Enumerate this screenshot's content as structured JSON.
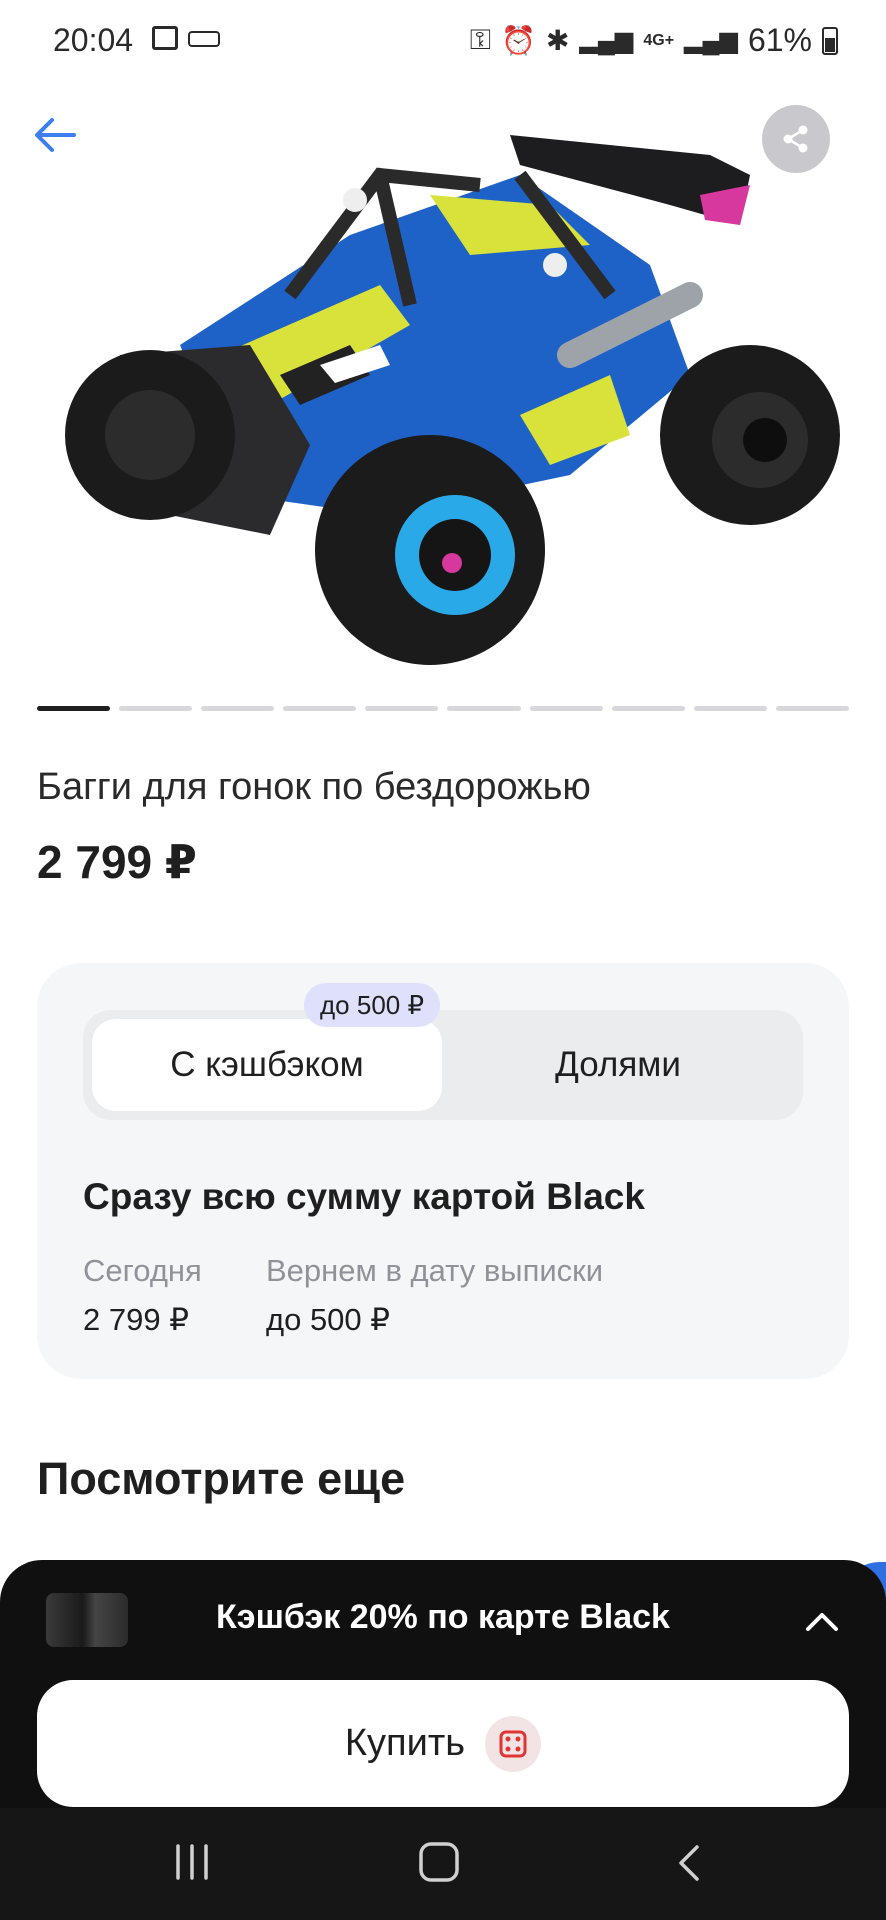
{
  "status_bar": {
    "time": "20:04",
    "battery": "61%",
    "network": "4G+"
  },
  "product": {
    "title": "Багги для гонок по бездорожью",
    "price": "2 799 ₽",
    "image_pages": 10,
    "active_page": 1
  },
  "payment": {
    "tabs": [
      {
        "label": "С кэшбэком",
        "selected": true
      },
      {
        "label": "Долями",
        "selected": false
      }
    ],
    "cashback_badge": "до 500 ₽",
    "heading": "Сразу всю сумму картой Black",
    "today_label": "Сегодня",
    "today_value": "2 799 ₽",
    "return_label": "Вернем в дату выписки",
    "return_value": "до 500 ₽"
  },
  "section": {
    "title": "Посмотрите еще"
  },
  "bottom_sheet": {
    "cashback_text": "Кэшбэк 20% по карте Black",
    "buy_label": "Купить"
  },
  "colors": {
    "accent_blue": "#3d7ef0",
    "sheet_bg": "#101010",
    "card_bg": "#f5f6f7",
    "badge_bg": "#dfe0fb",
    "brand_red": "#e03535"
  },
  "icons": [
    "back-arrow-icon",
    "share-icon",
    "chevron-up-icon",
    "dice-icon",
    "recent-apps-icon",
    "home-icon",
    "nav-back-icon"
  ]
}
